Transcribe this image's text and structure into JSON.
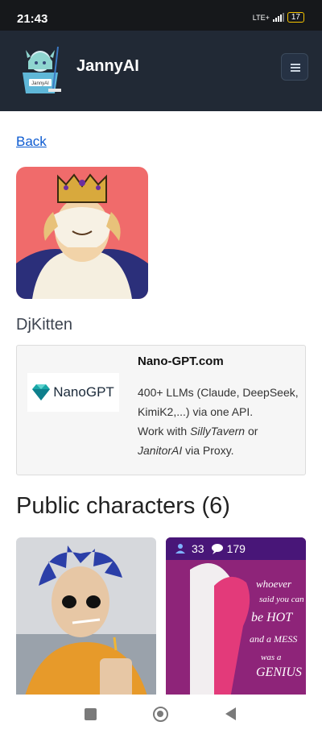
{
  "status_bar": {
    "time": "21:43",
    "network": "LTE+",
    "battery": "17"
  },
  "header": {
    "brand": "JannyAI",
    "logo_text": "JannyAI"
  },
  "page": {
    "back_link": "Back",
    "username": "DjKitten"
  },
  "ad": {
    "logo_name": "NanoGPT",
    "title": "Nano-GPT.com",
    "line1": "400+ LLMs (Claude, DeepSeek, KimiK2,...) via one API.",
    "line2_prefix": "Work with ",
    "line2_em1": "SillyTavern",
    "line2_mid": " or ",
    "line2_em2": "JanitorAI",
    "line2_suffix": " via Proxy."
  },
  "section": {
    "title": "Public characters (6)"
  },
  "characters": [
    {
      "label": "character-1"
    },
    {
      "chats": "33",
      "messages": "179"
    }
  ],
  "colors": {
    "navbar": "#212935",
    "link": "#0d5bd1",
    "stats_bg": "#3c1478"
  }
}
